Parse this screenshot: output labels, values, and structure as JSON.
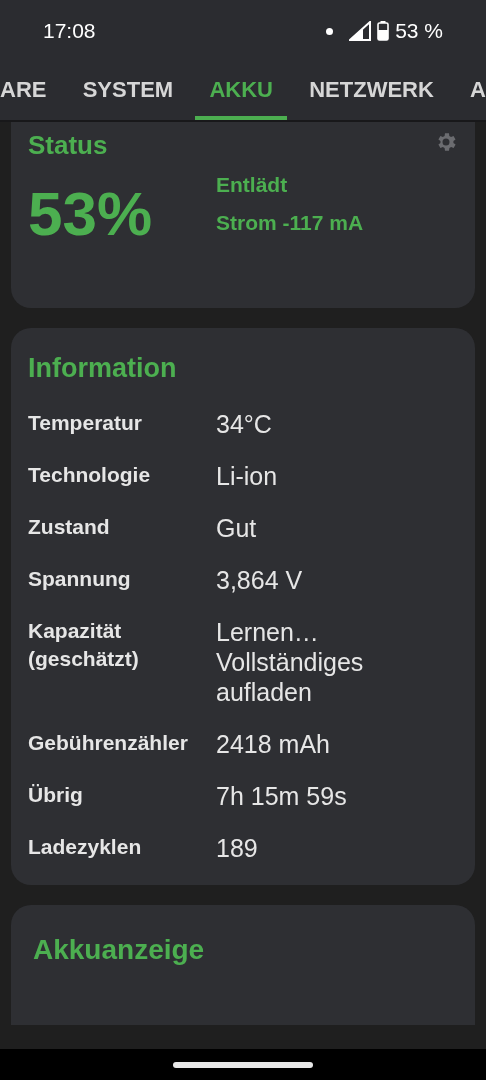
{
  "status_bar": {
    "time": "17:08",
    "battery": "53 %"
  },
  "tabs": [
    {
      "label": "ARE",
      "selected": false
    },
    {
      "label": "SYSTEM",
      "selected": false
    },
    {
      "label": "AKKU",
      "selected": true
    },
    {
      "label": "NETZWERK",
      "selected": false
    },
    {
      "label": "A",
      "selected": false
    }
  ],
  "status_card": {
    "title": "Status",
    "percent": "53%",
    "state": "Entlädt",
    "current": "Strom -117 mA"
  },
  "information": {
    "title": "Information",
    "rows": [
      {
        "label": "Temperatur",
        "value": "34°C"
      },
      {
        "label": "Technologie",
        "value": "Li-ion"
      },
      {
        "label": "Zustand",
        "value": "Gut"
      },
      {
        "label": "Spannung",
        "value": "3,864 V"
      },
      {
        "label": "Kapazität (geschätzt)",
        "value": "Lernen… Vollständiges aufladen"
      },
      {
        "label": "Gebührenzähler",
        "value": "2418 mAh"
      },
      {
        "label": "Übrig",
        "value": "7h 15m 59s"
      },
      {
        "label": "Ladezyklen",
        "value": "189"
      }
    ]
  },
  "next_card": {
    "title": "Akkuanzeige"
  }
}
